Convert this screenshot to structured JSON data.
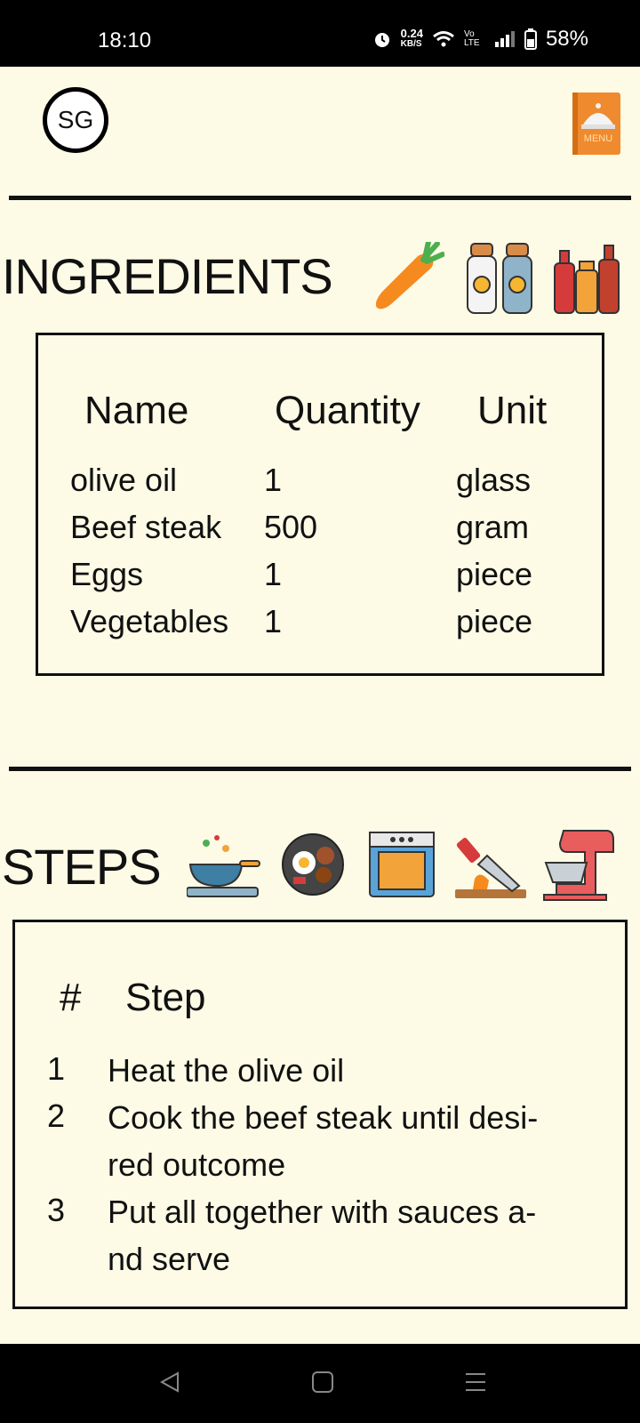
{
  "status_bar": {
    "time": "18:10",
    "net_speed_value": "0.24",
    "net_speed_unit": "KB/S",
    "lte_label": "Vo LTE",
    "battery": "58%"
  },
  "header": {
    "avatar_initials": "SG",
    "menu_label": "MENU"
  },
  "ingredients": {
    "title": "INGREDIENTS",
    "columns": [
      "Name",
      "Quantity",
      "Unit"
    ],
    "rows": [
      {
        "name": "olive oil",
        "quantity": "1",
        "unit": "glass"
      },
      {
        "name": "Beef steak",
        "quantity": "500",
        "unit": "gram"
      },
      {
        "name": "Eggs",
        "quantity": "1",
        "unit": "piece"
      },
      {
        "name": "Vegetables",
        "quantity": "1",
        "unit": "piece"
      }
    ]
  },
  "steps": {
    "title": "STEPS",
    "columns": [
      "#",
      "Step"
    ],
    "rows": [
      {
        "num": "1",
        "line1": "Heat the olive oil",
        "line2": ""
      },
      {
        "num": "2",
        "line1": "Cook the beef steak until desi-",
        "line2": "red outcome"
      },
      {
        "num": "3",
        "line1": "Put all together with sauces a-",
        "line2": "nd serve"
      }
    ]
  },
  "icons": {
    "ingredients": [
      "carrot-icon",
      "salt-pepper-icon",
      "sauces-icon"
    ],
    "steps": [
      "wok-icon",
      "pan-meal-icon",
      "oven-icon",
      "knife-board-icon",
      "mixer-icon"
    ]
  },
  "colors": {
    "background": "#FDFBE6",
    "menu_orange": "#F08A2E",
    "bars": "#000000"
  }
}
